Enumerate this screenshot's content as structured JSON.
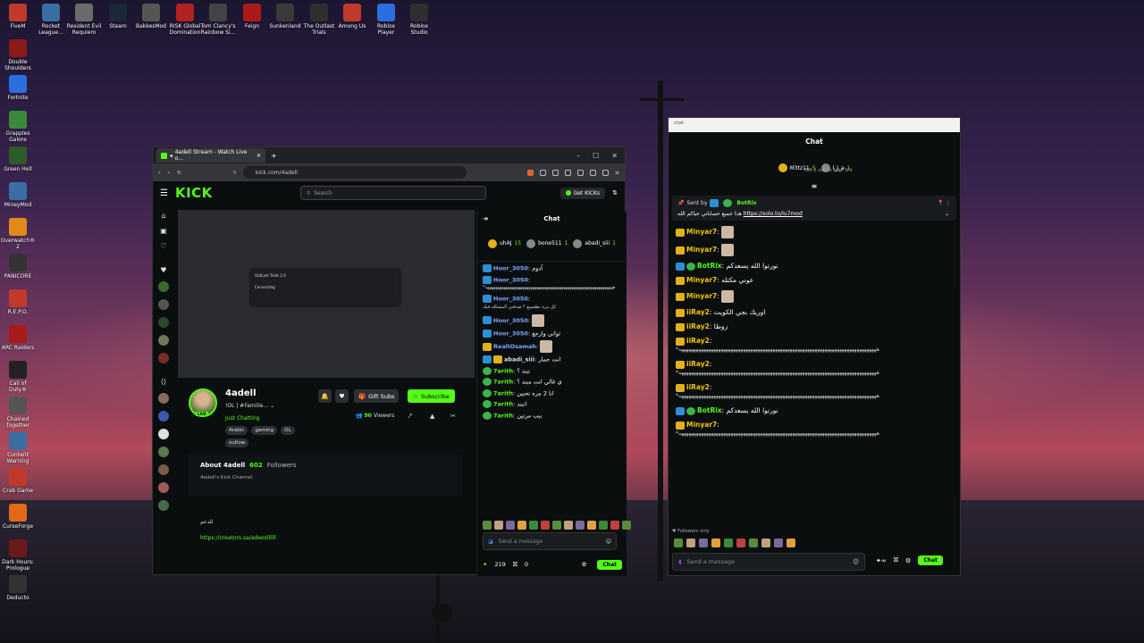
{
  "desktop": {
    "top_icons": [
      {
        "label": "FiveM",
        "color": "#c0392b"
      },
      {
        "label": "Rocket League...",
        "color": "#3a6ea5"
      },
      {
        "label": "Resident Evil Requiem",
        "color": "#6b6b6b"
      },
      {
        "label": "Steam",
        "color": "#1b2838"
      },
      {
        "label": "BakkesMod",
        "color": "#555555"
      },
      {
        "label": "RISK Global Domination",
        "color": "#b22222"
      },
      {
        "label": "Tom Clancy's Rainbow Si...",
        "color": "#444444"
      },
      {
        "label": "Feign",
        "color": "#aa1a1a"
      },
      {
        "label": "Sunkenland",
        "color": "#3a3a3a"
      },
      {
        "label": "The Outlast Trials",
        "color": "#2f2f2f"
      },
      {
        "label": "Among Us",
        "color": "#c0392b"
      },
      {
        "label": "Roblox Player",
        "color": "#2a6ee0"
      },
      {
        "label": "Roblox Studio",
        "color": "#2f2f2f"
      }
    ],
    "left_icons": [
      {
        "label": "Double Shoulders",
        "color": "#8b1a1a"
      },
      {
        "label": "Fortnite",
        "color": "#2a6ee0"
      },
      {
        "label": "Grapples Galore",
        "color": "#3a8a3a"
      },
      {
        "label": "Green Hell",
        "color": "#2f5a2a"
      },
      {
        "label": "MineyMod",
        "color": "#3a6ea5"
      },
      {
        "label": "Overwatch® 2",
        "color": "#e08a1a"
      },
      {
        "label": "PANICORE",
        "color": "#333333"
      },
      {
        "label": "R.E.P.O.",
        "color": "#c0392b"
      },
      {
        "label": "ARC Raiders",
        "color": "#aa1a1a"
      },
      {
        "label": "Call of Duty®",
        "color": "#222222"
      },
      {
        "label": "Chained Together",
        "color": "#555555"
      },
      {
        "label": "Content Warning",
        "color": "#3a6ea5"
      },
      {
        "label": "Crab Game",
        "color": "#c0392b"
      },
      {
        "label": "CurseForge",
        "color": "#e06a1a"
      },
      {
        "label": "Dark Hours: Prologue",
        "color": "#6a1a1a"
      },
      {
        "label": "Deducto",
        "color": "#333333"
      }
    ]
  },
  "browser": {
    "tab_title": "4adell Stream - Watch Live o...",
    "url": "kick.com/4adell",
    "logo": "KICK",
    "search_placeholder": "Search",
    "get_kicks": "Get KICKs",
    "dialog": {
      "title": "OutLast Trials 2.0",
      "status": "Connecting"
    },
    "channel": {
      "name": "4adell",
      "live": "LIVE",
      "title": "!OL | #Familie...",
      "category": "Just Chatting",
      "tags": [
        "Arabic",
        "gaming",
        "OL",
        "outlow"
      ],
      "gift_subs": "Gift Subs",
      "subscribe": "Subscribe",
      "viewers_count": "90",
      "viewers_label": "Viewers"
    },
    "about": {
      "title": "About 4adell",
      "followers_count": "602",
      "followers_label": "Followers",
      "subtitle": "4adell's Kick Channel"
    },
    "bio_text": "للدعم",
    "bio_link": "https://creators.sa/adeesllllll",
    "chat": {
      "title": "Chat",
      "pinned": [
        {
          "user": "uhAJ",
          "amount": "15"
        },
        {
          "user": "bone511",
          "amount": "1"
        },
        {
          "user": "abadi_siii",
          "amount": "1"
        }
      ],
      "messages": [
        {
          "user": "Hoor_3050",
          "text": "آدوم"
        },
        {
          "user": "Hoor_3050",
          "text": "*ههههههههههههههههههههههههههههههههههههههههههههههههههههههههههههههه"
        },
        {
          "user": "Hoor_3050",
          "text": "كل مره تطقيييع ؟ صدقني المشكله فيك"
        },
        {
          "user": "Hoor_3050",
          "text": ""
        },
        {
          "user": "Hoor_3050",
          "text": "ثواني وارجع"
        },
        {
          "user": "RealIOsamah",
          "text": ""
        },
        {
          "user": "abadi_siii",
          "text": "انت حمار"
        },
        {
          "user": "7arith",
          "text": "تبند ؟"
        },
        {
          "user": "7arith",
          "text": "ي غالي انت مبند ؟"
        },
        {
          "user": "7arith",
          "text": "انا 2 مره تحبين"
        },
        {
          "user": "7arith",
          "text": "اتبند"
        },
        {
          "user": "7arith",
          "text": "ببب مرتين"
        }
      ],
      "input_placeholder": "Send a message",
      "kicks_count": "219",
      "gift_count": "0",
      "chat_button": "Chat"
    }
  },
  "popout": {
    "window_title": "chat",
    "title": "Chat",
    "pinned": [
      {
        "user": "M3tz11",
        "amount": "5"
      },
      {
        "user": "l_l_a",
        "amount": "1"
      }
    ],
    "gift_note": "Gift 1 sub to take 3rd",
    "pinned_msg": {
      "sent_by_label": "Sent by",
      "sent_by_user": "BotRix",
      "text": "هذا جميع حساباتي حياكم الله",
      "link": "https://solo.to/lu7mod"
    },
    "messages": [
      {
        "user": "Minyar7",
        "text": ""
      },
      {
        "user": "Minyar7",
        "text": ""
      },
      {
        "user": "BotRix",
        "text": "نورتوا الله يسعدكم"
      },
      {
        "user": "Minyar7",
        "text": "عوني مكتله"
      },
      {
        "user": "Minyar7",
        "text": ""
      },
      {
        "user": "iiRay2",
        "text": "اوريك بجي الكويت"
      },
      {
        "user": "iiRay2",
        "text": "زوطا"
      },
      {
        "user": "iiRay2",
        "text": "*ههههههههههههههههههههههههههههههههههههههههههههههههههههههههههههههههههههههههههههههههه"
      },
      {
        "user": "iiRay2",
        "text": "*ههههههههههههههههههههههههههههههههههههههههههههههههههههههههههههههههههههههههههههههههه"
      },
      {
        "user": "iiRay2",
        "text": "*ههههههههههههههههههههههههههههههههههههههههههههههههههههههههههههههههههههههههههههههههه"
      },
      {
        "user": "BotRix",
        "text": "نورتوا الله يسعدكم"
      },
      {
        "user": "Minyar7",
        "text": "*ههههههههههههههههههههههههههههههههههههههههههههههههههههههههههههههههههههههههههههههههه"
      }
    ],
    "followers_only": "Followers only",
    "input_placeholder": "Send a message",
    "chat_button": "Chat"
  }
}
